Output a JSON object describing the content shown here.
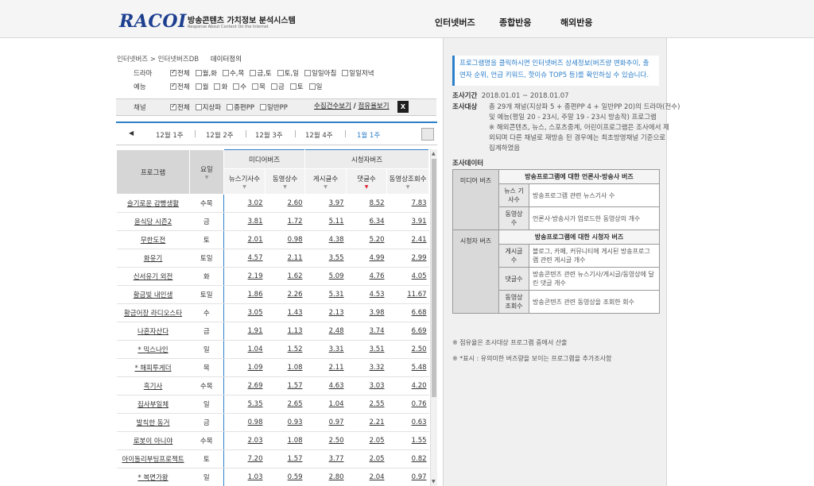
{
  "header": {
    "logo": "RACOI",
    "title": "방송콘텐츠 가치정보 분석시스템",
    "subtitle": "Response About Content On the Internet",
    "nav": [
      "인터넷버즈",
      "종합반응",
      "해외반응"
    ]
  },
  "breadcrumb": {
    "path": "인터넷버즈 > 인터넷버즈DB",
    "extra": "데이터정의"
  },
  "filters": {
    "drama": {
      "label": "드라마",
      "options": [
        {
          "label": "전체",
          "checked": true
        },
        {
          "label": "월,화",
          "checked": false
        },
        {
          "label": "수,목",
          "checked": false
        },
        {
          "label": "금,토",
          "checked": false
        },
        {
          "label": "토,일",
          "checked": false
        },
        {
          "label": "일일아침",
          "checked": false
        },
        {
          "label": "일일저녁",
          "checked": false
        }
      ]
    },
    "variety": {
      "label": "예능",
      "options": [
        {
          "label": "전체",
          "checked": true
        },
        {
          "label": "월",
          "checked": false
        },
        {
          "label": "화",
          "checked": false
        },
        {
          "label": "수",
          "checked": false
        },
        {
          "label": "목",
          "checked": false
        },
        {
          "label": "금",
          "checked": false
        },
        {
          "label": "토",
          "checked": false
        },
        {
          "label": "일",
          "checked": false
        }
      ]
    },
    "channel": {
      "label": "채널",
      "options": [
        {
          "label": "전체",
          "checked": true
        },
        {
          "label": "지상파",
          "checked": false
        },
        {
          "label": "종편PP",
          "checked": false
        },
        {
          "label": "일반PP",
          "checked": false
        }
      ]
    }
  },
  "view_links": {
    "count": "수집건수보기",
    "share": "점유율보기",
    "divider": "/"
  },
  "excel_icon": "X",
  "weeks": {
    "prev": "◀",
    "items": [
      "12월 1주",
      "12월 2주",
      "12월 3주",
      "12월 4주",
      "1월 1주"
    ],
    "selected": 4
  },
  "table": {
    "groups": {
      "program": "프로그램",
      "day": "요일",
      "media": "미디어버즈",
      "viewer": "시청자버즈"
    },
    "columns": [
      "뉴스기사수",
      "동영상수",
      "게시글수",
      "댓글수",
      "동영상조회수"
    ],
    "rows": [
      {
        "name": "슬기로운 감빵생활",
        "day": "수목",
        "v": [
          "3.02",
          "2.60",
          "3.97",
          "8.52",
          "7.83"
        ]
      },
      {
        "name": "윤식당 시즌2",
        "day": "금",
        "v": [
          "3.81",
          "1.72",
          "5.11",
          "6.34",
          "3.91"
        ]
      },
      {
        "name": "무한도전",
        "day": "토",
        "v": [
          "2.01",
          "0.98",
          "4.38",
          "5.20",
          "2.41"
        ]
      },
      {
        "name": "화유기",
        "day": "토일",
        "v": [
          "4.57",
          "2.11",
          "3.55",
          "4.99",
          "2.99"
        ]
      },
      {
        "name": "신서유기 외전",
        "day": "화",
        "v": [
          "2.19",
          "1.62",
          "5.09",
          "4.76",
          "4.05"
        ]
      },
      {
        "name": "황금빛 내인생",
        "day": "토일",
        "v": [
          "1.86",
          "2.26",
          "5.31",
          "4.53",
          "11.67"
        ]
      },
      {
        "name": "황금어장 라디오스타",
        "day": "수",
        "v": [
          "3.05",
          "1.43",
          "2.13",
          "3.98",
          "6.68"
        ]
      },
      {
        "name": "나혼자산다",
        "day": "금",
        "v": [
          "1.91",
          "1.13",
          "2.48",
          "3.74",
          "6.69"
        ]
      },
      {
        "name": "* 믹스나인",
        "day": "일",
        "v": [
          "1.04",
          "1.52",
          "3.31",
          "3.51",
          "2.50"
        ]
      },
      {
        "name": "* 해피투게더",
        "day": "목",
        "v": [
          "1.09",
          "1.08",
          "2.11",
          "3.32",
          "5.48"
        ]
      },
      {
        "name": "흑기사",
        "day": "수목",
        "v": [
          "2.69",
          "1.57",
          "4.63",
          "3.03",
          "4.20"
        ]
      },
      {
        "name": "집사부일체",
        "day": "일",
        "v": [
          "5.35",
          "2.65",
          "1.04",
          "2.55",
          "0.76"
        ]
      },
      {
        "name": "발칙한 동거",
        "day": "금",
        "v": [
          "0.98",
          "0.93",
          "0.97",
          "2.21",
          "0.63"
        ]
      },
      {
        "name": "로봇이 아니야",
        "day": "수목",
        "v": [
          "2.03",
          "1.08",
          "2.50",
          "2.05",
          "1.55"
        ]
      },
      {
        "name": "아이돌리부팅프로젝트",
        "day": "토",
        "v": [
          "7.20",
          "1.57",
          "3.77",
          "2.05",
          "0.82"
        ]
      },
      {
        "name": "* 복면가왕",
        "day": "일",
        "v": [
          "1.03",
          "0.59",
          "2.80",
          "2.04",
          "0.97"
        ]
      }
    ]
  },
  "right": {
    "notice": "프로그램명을 클릭하시면 인터넷버즈 상세정보(버즈량 변화추이, 출연자 순위, 언급 키워드, 핫이슈 TOP5 등)를 확인하실 수 있습니다.",
    "period_label": "조사기간",
    "period": "2018.01.01 ~ 2018.01.07",
    "target_label": "조사대상",
    "target_lines": [
      "총 29개 채널(지상파 5 + 종편PP 4 + 일반PP 20)의 드라마(전수)",
      "및 예능(평일 20 - 23시, 주말 19 - 23시 방송작) 프로그램",
      "※ 해외콘텐츠, 뉴스, 스포츠중계, 어린이프로그램은 조사에서 제",
      "외되며 다른 채널로 재방송 된 경우에는 최초방영채널 기준으로",
      "집계하였음"
    ],
    "data_title": "조사데이터",
    "definitions": [
      {
        "cat": "미디어 버즈",
        "head": "방송프로그램에 대한 언론사·방송사 버즈",
        "items": [
          {
            "k": "뉴스 기사수",
            "v": "방송프로그램 관련 뉴스기사 수"
          },
          {
            "k": "동영상수",
            "v": "언론사·방송사가 업로드한 동영상의 개수"
          }
        ]
      },
      {
        "cat": "시청자 버즈",
        "head": "방송프로그램에 대한 시청자 버즈",
        "items": [
          {
            "k": "게시글수",
            "v": "블로그, 카페, 커뮤니티에 게시된 방송프로그램 관련 게시글 개수"
          },
          {
            "k": "댓글수",
            "v": "방송콘텐츠 관련 뉴스기사/게시글/동영상에 달린 댓글 개수"
          },
          {
            "k": "동영상 조회수",
            "v": "방송콘텐츠 관련 동영상을 조회한 회수"
          }
        ]
      }
    ],
    "note1": "※ 점유율은 조사대상 프로그램 중에서 산출",
    "note2": "※ *표시 : 유의미한 버즈량을 보이는 프로그램을 추가조사함"
  },
  "colors": {
    "accent": "#2c7fc9",
    "logo": "#1d3f8f"
  }
}
